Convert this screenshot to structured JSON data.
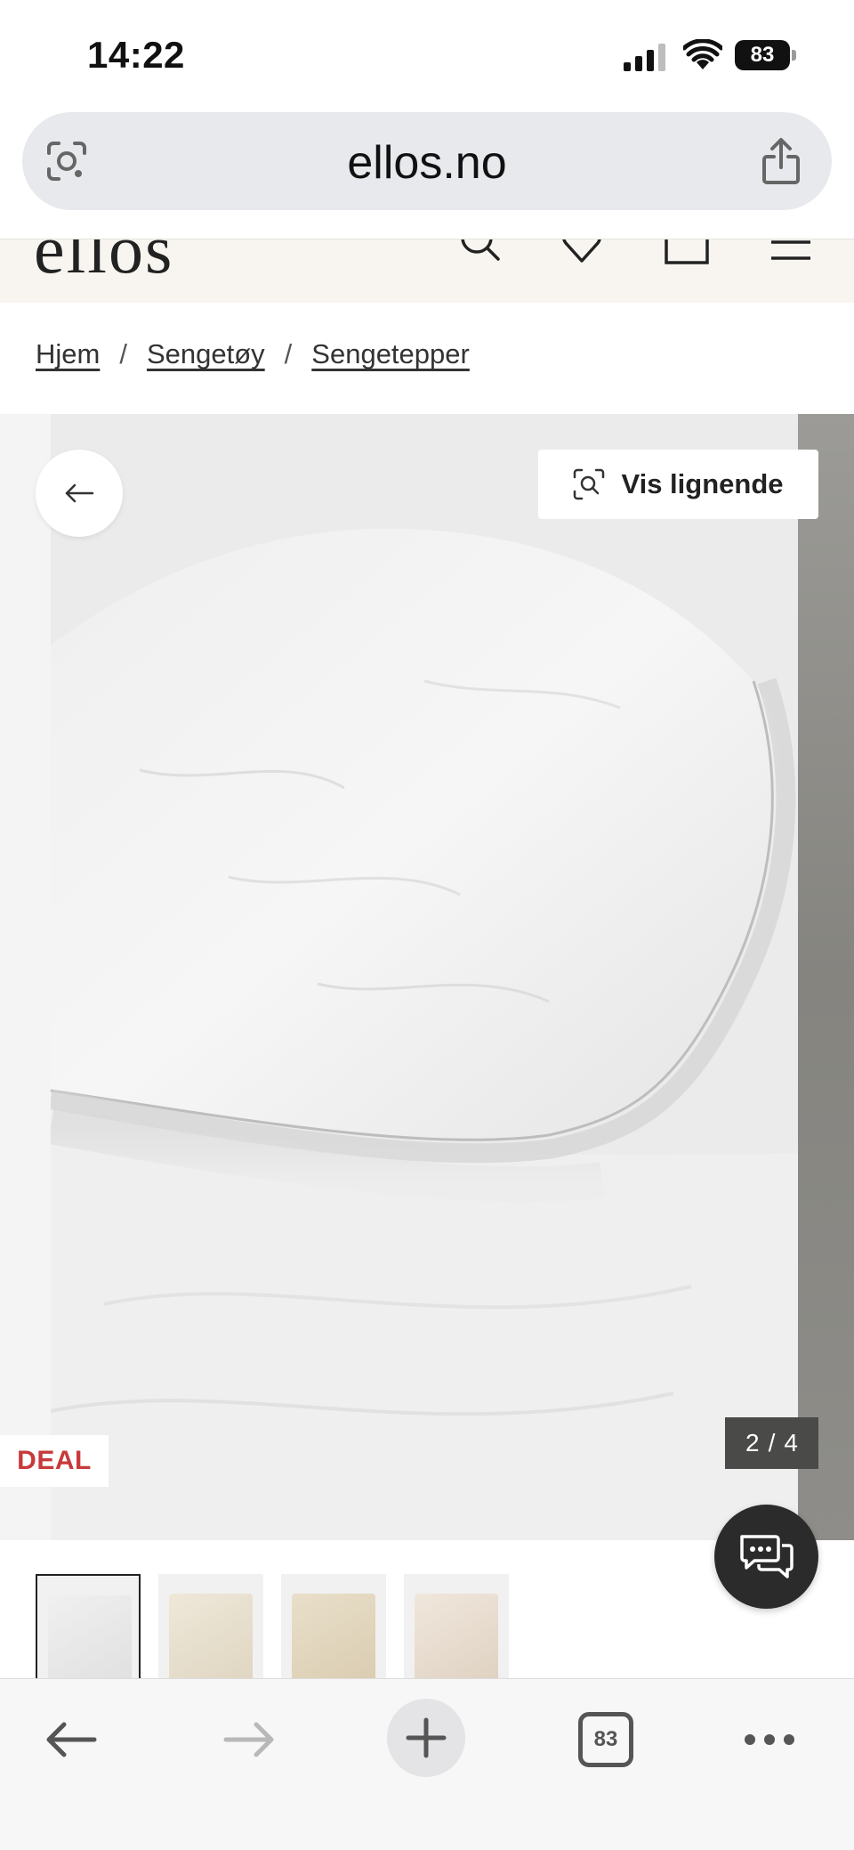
{
  "status_bar": {
    "time": "14:22",
    "battery": "83",
    "signal_icon": "cellular-signal-icon",
    "wifi_icon": "wifi-icon"
  },
  "url_bar": {
    "domain": "ellos.no",
    "left_icon": "visual-search-lens-icon",
    "right_icon": "share-icon"
  },
  "site_header": {
    "logo": "ellos",
    "icons": [
      "search-icon",
      "heart-icon",
      "bag-icon",
      "menu-icon"
    ]
  },
  "breadcrumb": {
    "items": [
      "Hjem",
      "Sengetøy",
      "Sengetepper"
    ],
    "separator": "/"
  },
  "gallery": {
    "back_icon": "arrow-left-icon",
    "similar_label": "Vis lignende",
    "similar_icon": "visual-search-icon",
    "deal_badge": "DEAL",
    "current": "2",
    "separator": "/",
    "total": "4",
    "chat_icon": "chat-bubbles-icon"
  },
  "thumbnails": {
    "active_index": 0,
    "colors": [
      "#e8e8e8",
      "#ece5d6",
      "#e6ddc9",
      "#ede3d8"
    ]
  },
  "browser_toolbar": {
    "tab_count": "83",
    "icons": [
      "back-arrow-icon",
      "forward-arrow-icon",
      "plus-icon",
      "tabs-icon",
      "more-icon"
    ]
  },
  "colors": {
    "deal_red": "#c83a3a",
    "header_bg": "#f8f5f1",
    "counter_bg": "#4a4a48"
  }
}
